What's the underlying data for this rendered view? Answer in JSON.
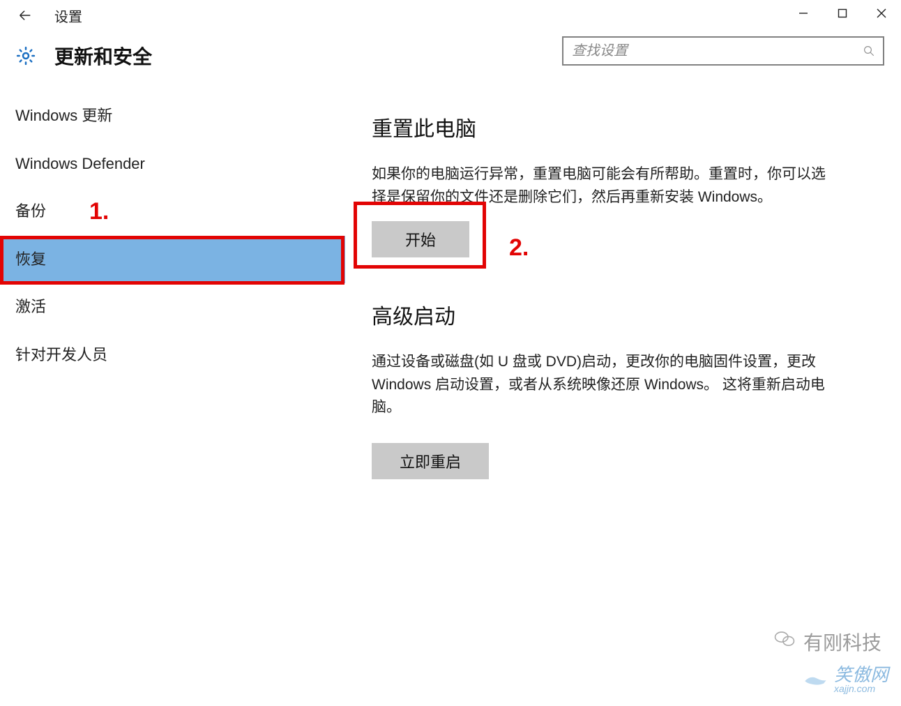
{
  "window": {
    "title": "设置",
    "minimize_label": "Minimize",
    "maximize_label": "Maximize",
    "close_label": "Close"
  },
  "header": {
    "section_title": "更新和安全",
    "search_placeholder": "查找设置"
  },
  "sidebar": {
    "items": [
      {
        "label": "Windows 更新",
        "id": "windows-update"
      },
      {
        "label": "Windows Defender",
        "id": "windows-defender"
      },
      {
        "label": "备份",
        "id": "backup"
      },
      {
        "label": "恢复",
        "id": "recovery",
        "selected": true
      },
      {
        "label": "激活",
        "id": "activation"
      },
      {
        "label": "针对开发人员",
        "id": "for-developers"
      }
    ]
  },
  "main": {
    "reset": {
      "heading": "重置此电脑",
      "description": "如果你的电脑运行异常，重置电脑可能会有所帮助。重置时，你可以选择是保留你的文件还是删除它们，然后再重新安装 Windows。",
      "button_label": "开始"
    },
    "advanced": {
      "heading": "高级启动",
      "description": "通过设备或磁盘(如 U 盘或 DVD)启动，更改你的电脑固件设置，更改 Windows 启动设置，或者从系统映像还原 Windows。 这将重新启动电脑。",
      "button_label": "立即重启"
    }
  },
  "annotations": {
    "step1": "1.",
    "step2": "2."
  },
  "watermarks": {
    "brand1": "有刚科技",
    "brand2": "笑傲网",
    "brand2_sub": "xajjn.com"
  },
  "colors": {
    "accent_selection": "#7bb3e3",
    "annotation_red": "#e20404",
    "button_gray": "#c9c9c9"
  }
}
